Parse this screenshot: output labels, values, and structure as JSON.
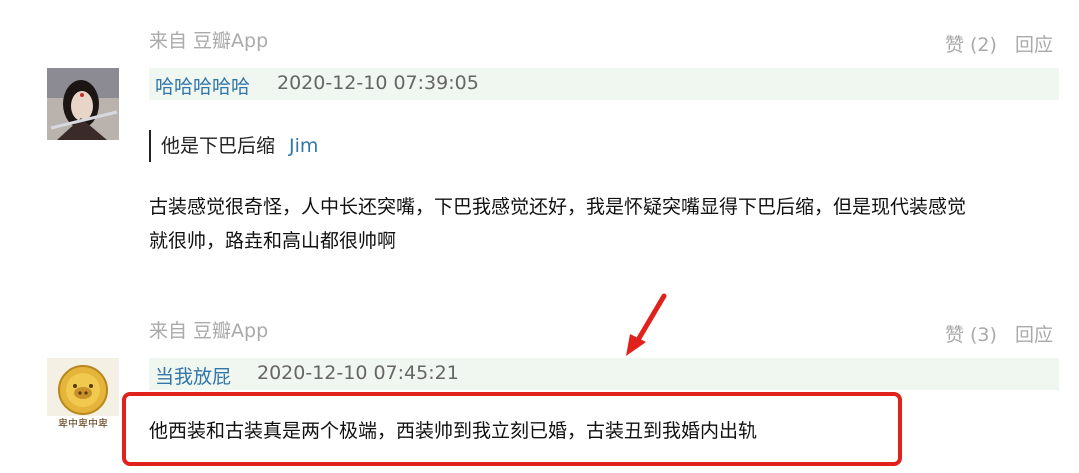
{
  "comments": [
    {
      "source": "来自 豆瓣App",
      "like": "赞 (2)",
      "reply": "回应",
      "username": "哈哈哈哈哈",
      "timestamp": "2020-12-10 07:39:05",
      "quote_text": "他是下巴后缩",
      "quote_author": "Jim",
      "content_line1": "古装感觉很奇怪，人中长还突嘴，下巴我感觉还好，我是怀疑突嘴显得下巴后缩，但是现代装感觉",
      "content_line2": "就很帅，路垚和高山都很帅啊"
    },
    {
      "source": "来自 豆瓣App",
      "like": "赞 (3)",
      "reply": "回应",
      "username": "当我放屁",
      "timestamp": "2020-12-10 07:45:21",
      "content": "他西装和古装真是两个极端，西装帅到我立刻已婚，古装丑到我婚内出轨",
      "avatar_text": "卑中卑中卑"
    }
  ],
  "colors": {
    "link": "#3377aa",
    "header_bg": "#f0f6f0",
    "muted": "#aaaaaa",
    "highlight": "#e0211c"
  }
}
